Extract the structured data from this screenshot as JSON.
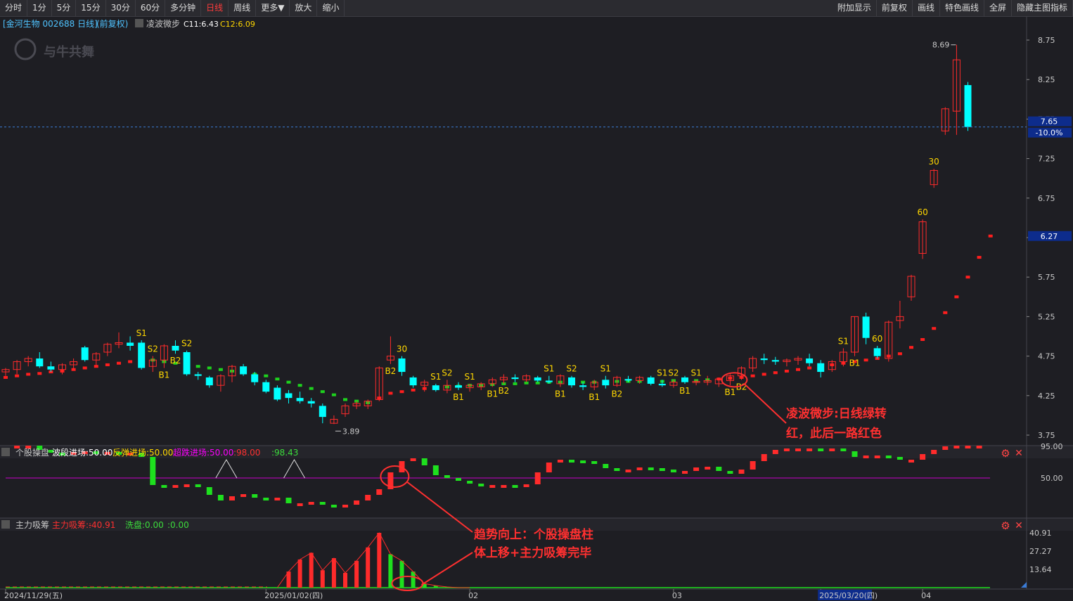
{
  "toolbar": {
    "left": [
      "分时",
      "1分",
      "5分",
      "15分",
      "30分",
      "60分",
      "多分钟",
      "日线",
      "周线",
      "更多▼",
      "放大",
      "缩小"
    ],
    "active": "日线",
    "right": [
      "附加显示",
      "前复权",
      "画线",
      "特色画线",
      "全屏",
      "隐藏主图指标"
    ]
  },
  "colors": {
    "bg": "#1e1e23",
    "up": "#ff2b2b",
    "down": "#00ffff",
    "ma_up": "#ff1e1e",
    "ma_down": "#1ed21e",
    "signal": "#ffd700",
    "grid": "#2e2e34",
    "annot": "#ff3030"
  },
  "main": {
    "stock_label": "[金河生物 002688 日线]",
    "adjust_label": "(前复权)",
    "indicator_name": "凌波微步",
    "c11": "C11:6.43",
    "c12": "C12:6.09",
    "watermark": "与牛共舞",
    "y_ticks": [
      "8.75",
      "8.25",
      "7.75",
      "7.25",
      "6.75",
      "6.25",
      "5.75",
      "5.25",
      "4.75",
      "4.25",
      "3.75"
    ],
    "price_box": "7.65",
    "pct_box": "-10.0%",
    "ma_box": "6.27",
    "high_label": "8.69",
    "low_label": "3.89",
    "annotation": [
      "凌波微步:日线绿转",
      "红，此后一路红色"
    ]
  },
  "panel1": {
    "title": "个股操盘",
    "items": [
      {
        "text": "波段进场:50.00",
        "color": "#ffffff"
      },
      {
        "text": "反弹进场:50.00",
        "color": "#ffd700"
      },
      {
        "text": "超跌进场:50.00",
        "color": "#ff00ff"
      },
      {
        "text": ":98.00",
        "color": "#ff3030"
      },
      {
        "text": ":98.43",
        "color": "#3cdc3c"
      }
    ],
    "y_ticks": [
      "95.00",
      "50.00"
    ]
  },
  "panel2": {
    "title": "主力吸筹",
    "items": [
      {
        "text": "主力吸筹:-",
        "color": "#ff3030"
      },
      {
        "text": ":40.91",
        "color": "#ff3030"
      },
      {
        "text": "洗盘:0.00",
        "color": "#3cdc3c"
      },
      {
        "text": ":0.00",
        "color": "#3cdc3c"
      }
    ],
    "y_ticks": [
      "40.91",
      "27.27",
      "13.64"
    ],
    "annotation": [
      "趋势向上：个股操盘柱",
      "体上移+主力吸筹完毕"
    ]
  },
  "x_axis": {
    "labels": [
      {
        "text": "2024/11/29(五)",
        "idx": 0
      },
      {
        "text": "2025/01/02(四)",
        "idx": 23
      },
      {
        "text": "02",
        "idx": 41
      },
      {
        "text": "03",
        "idx": 59
      },
      {
        "text": "2025/03/20(四)",
        "idx": 72,
        "highlight": true
      },
      {
        "text": "04",
        "idx": 81
      }
    ]
  },
  "chart_data": {
    "type": "candlestick",
    "y_range": [
      3.6,
      8.9
    ],
    "candles": [
      [
        4.55,
        4.6,
        4.5,
        4.58
      ],
      [
        4.58,
        4.7,
        4.52,
        4.68
      ],
      [
        4.68,
        4.75,
        4.62,
        4.72
      ],
      [
        4.72,
        4.8,
        4.6,
        4.62
      ],
      [
        4.62,
        4.68,
        4.55,
        4.58
      ],
      [
        4.58,
        4.66,
        4.52,
        4.64
      ],
      [
        4.64,
        4.72,
        4.58,
        4.68
      ],
      [
        4.86,
        4.88,
        4.68,
        4.7
      ],
      [
        4.7,
        4.8,
        4.62,
        4.78
      ],
      [
        4.8,
        4.92,
        4.75,
        4.9
      ],
      [
        4.9,
        5.05,
        4.85,
        4.92
      ],
      [
        4.92,
        5.0,
        4.82,
        4.88
      ],
      [
        4.92,
        4.95,
        4.58,
        4.6
      ],
      [
        4.62,
        4.75,
        4.55,
        4.7
      ],
      [
        4.7,
        4.9,
        4.6,
        4.88
      ],
      [
        4.88,
        4.95,
        4.78,
        4.82
      ],
      [
        4.8,
        4.82,
        4.5,
        4.52
      ],
      [
        4.52,
        4.55,
        4.45,
        4.5
      ],
      [
        4.48,
        4.5,
        4.35,
        4.38
      ],
      [
        4.38,
        4.52,
        4.3,
        4.5
      ],
      [
        4.5,
        4.64,
        4.42,
        4.62
      ],
      [
        4.62,
        4.65,
        4.5,
        4.52
      ],
      [
        4.52,
        4.55,
        4.38,
        4.42
      ],
      [
        4.42,
        4.45,
        4.28,
        4.3
      ],
      [
        4.35,
        4.38,
        4.18,
        4.2
      ],
      [
        4.28,
        4.32,
        4.15,
        4.22
      ],
      [
        4.22,
        4.3,
        4.15,
        4.18
      ],
      [
        4.18,
        4.22,
        4.1,
        4.15
      ],
      [
        4.12,
        4.15,
        3.9,
        3.98
      ],
      [
        3.9,
        4.0,
        3.89,
        3.95
      ],
      [
        4.02,
        4.15,
        3.98,
        4.12
      ],
      [
        4.12,
        4.18,
        4.08,
        4.15
      ],
      [
        4.12,
        4.2,
        4.08,
        4.18
      ],
      [
        4.2,
        4.62,
        4.18,
        4.6
      ],
      [
        4.7,
        5.0,
        4.65,
        4.75
      ],
      [
        4.72,
        4.75,
        4.5,
        4.55
      ],
      [
        4.48,
        4.5,
        4.35,
        4.38
      ],
      [
        4.38,
        4.45,
        4.3,
        4.42
      ],
      [
        4.38,
        4.4,
        4.3,
        4.32
      ],
      [
        4.32,
        4.45,
        4.28,
        4.38
      ],
      [
        4.38,
        4.42,
        4.32,
        4.35
      ],
      [
        4.35,
        4.4,
        4.3,
        4.38
      ],
      [
        4.36,
        4.42,
        4.32,
        4.4
      ],
      [
        4.4,
        4.48,
        4.36,
        4.45
      ],
      [
        4.45,
        4.52,
        4.4,
        4.48
      ],
      [
        4.48,
        4.52,
        4.42,
        4.46
      ],
      [
        4.45,
        4.52,
        4.42,
        4.5
      ],
      [
        4.48,
        4.5,
        4.42,
        4.44
      ],
      [
        4.44,
        4.5,
        4.4,
        4.42
      ],
      [
        4.4,
        4.52,
        4.36,
        4.5
      ],
      [
        4.48,
        4.5,
        4.35,
        4.38
      ],
      [
        4.38,
        4.42,
        4.32,
        4.36
      ],
      [
        4.36,
        4.45,
        4.32,
        4.42
      ],
      [
        4.45,
        4.5,
        4.34,
        4.38
      ],
      [
        4.38,
        4.5,
        4.36,
        4.48
      ],
      [
        4.46,
        4.5,
        4.42,
        4.44
      ],
      [
        4.44,
        4.5,
        4.4,
        4.48
      ],
      [
        4.48,
        4.5,
        4.38,
        4.4
      ],
      [
        4.4,
        4.45,
        4.36,
        4.38
      ],
      [
        4.38,
        4.45,
        4.35,
        4.42
      ],
      [
        4.48,
        4.5,
        4.4,
        4.42
      ],
      [
        4.42,
        4.45,
        4.38,
        4.43
      ],
      [
        4.42,
        4.5,
        4.38,
        4.44
      ],
      [
        4.4,
        4.48,
        4.36,
        4.46
      ],
      [
        4.44,
        4.52,
        4.38,
        4.5
      ],
      [
        4.5,
        4.62,
        4.45,
        4.6
      ],
      [
        4.6,
        4.75,
        4.55,
        4.72
      ],
      [
        4.72,
        4.78,
        4.65,
        4.7
      ],
      [
        4.7,
        4.74,
        4.64,
        4.68
      ],
      [
        4.68,
        4.72,
        4.62,
        4.7
      ],
      [
        4.7,
        4.75,
        4.64,
        4.72
      ],
      [
        4.72,
        4.78,
        4.62,
        4.66
      ],
      [
        4.66,
        4.7,
        4.48,
        4.55
      ],
      [
        4.58,
        4.7,
        4.55,
        4.68
      ],
      [
        4.68,
        4.85,
        4.62,
        4.8
      ],
      [
        4.8,
        5.25,
        4.75,
        5.25
      ],
      [
        5.25,
        5.3,
        4.9,
        4.98
      ],
      [
        4.85,
        4.88,
        4.72,
        4.75
      ],
      [
        4.72,
        5.2,
        4.68,
        5.18
      ],
      [
        5.2,
        5.45,
        5.1,
        5.25
      ],
      [
        5.5,
        5.78,
        5.45,
        5.76
      ],
      [
        6.05,
        6.48,
        5.98,
        6.45
      ],
      [
        6.92,
        7.12,
        6.88,
        7.1
      ],
      [
        7.6,
        7.9,
        7.55,
        7.88
      ],
      [
        7.85,
        8.69,
        7.55,
        8.5
      ],
      [
        8.18,
        8.22,
        7.6,
        7.65
      ]
    ],
    "ma_values": [
      4.48,
      4.5,
      4.52,
      4.53,
      4.55,
      4.56,
      4.58,
      4.6,
      4.62,
      4.64,
      4.66,
      4.68,
      4.74,
      4.7,
      4.68,
      4.66,
      4.64,
      4.62,
      4.6,
      4.58,
      4.56,
      4.54,
      4.52,
      4.5,
      4.46,
      4.42,
      4.38,
      4.34,
      4.3,
      4.26,
      4.2,
      4.18,
      4.16,
      4.22,
      4.28,
      4.3,
      4.32,
      4.34,
      4.35,
      4.36,
      4.37,
      4.38,
      4.38,
      4.39,
      4.4,
      4.4,
      4.41,
      4.41,
      4.42,
      4.42,
      4.42,
      4.42,
      4.42,
      4.43,
      4.43,
      4.43,
      4.43,
      4.43,
      4.43,
      4.44,
      4.44,
      4.44,
      4.45,
      4.46,
      4.47,
      4.48,
      4.5,
      4.52,
      4.54,
      4.56,
      4.58,
      4.6,
      4.62,
      4.64,
      4.66,
      4.68,
      4.7,
      4.72,
      4.75,
      4.78,
      4.86,
      4.96,
      5.1,
      5.3,
      5.5,
      5.75,
      6.0,
      6.27
    ],
    "ma_red_from": 63,
    "ma_red_ranges": [
      [
        0,
        11
      ],
      [
        33,
        37
      ],
      [
        63,
        87
      ]
    ],
    "signals": [
      {
        "text": "S1",
        "idx": 12,
        "pos": "top"
      },
      {
        "text": "S2",
        "idx": 13,
        "pos": "top"
      },
      {
        "text": "S2",
        "idx": 16,
        "pos": "top"
      },
      {
        "text": "B2",
        "idx": 15,
        "pos": "bottom"
      },
      {
        "text": "B1",
        "idx": 14,
        "pos": "bottom"
      },
      {
        "text": "30",
        "idx": 35,
        "pos": "top"
      },
      {
        "text": "B2",
        "idx": 34,
        "pos": "bottom"
      },
      {
        "text": "S1",
        "idx": 38,
        "pos": "top"
      },
      {
        "text": "S2",
        "idx": 39,
        "pos": "top"
      },
      {
        "text": "B1",
        "idx": 40,
        "pos": "bottom"
      },
      {
        "text": "S1",
        "idx": 41,
        "pos": "top"
      },
      {
        "text": "B2",
        "idx": 44,
        "pos": "bottom"
      },
      {
        "text": "B1",
        "idx": 43,
        "pos": "bottom"
      },
      {
        "text": "S1",
        "idx": 48,
        "pos": "top"
      },
      {
        "text": "B1",
        "idx": 49,
        "pos": "bottom"
      },
      {
        "text": "S2",
        "idx": 50,
        "pos": "top"
      },
      {
        "text": "S1",
        "idx": 53,
        "pos": "top"
      },
      {
        "text": "B1",
        "idx": 52,
        "pos": "bottom"
      },
      {
        "text": "B2",
        "idx": 54,
        "pos": "bottom"
      },
      {
        "text": "S1",
        "idx": 58,
        "pos": "top"
      },
      {
        "text": "S2",
        "idx": 59,
        "pos": "top"
      },
      {
        "text": "B1",
        "idx": 60,
        "pos": "bottom"
      },
      {
        "text": "S1",
        "idx": 61,
        "pos": "top"
      },
      {
        "text": "B1",
        "idx": 64,
        "pos": "bottom"
      },
      {
        "text": "B2",
        "idx": 65,
        "pos": "bottom"
      },
      {
        "text": "S1",
        "idx": 74,
        "pos": "top"
      },
      {
        "text": "B1",
        "idx": 75,
        "pos": "bottom"
      },
      {
        "text": "60",
        "idx": 77,
        "pos": "top"
      },
      {
        "text": "30",
        "idx": 82,
        "pos": "top"
      },
      {
        "text": "60",
        "idx": 81,
        "pos": "top"
      }
    ],
    "panel1_values": [
      96,
      96,
      96,
      90,
      86,
      84,
      87,
      88,
      86,
      87,
      86,
      86,
      80,
      40,
      38,
      40,
      41,
      37,
      26,
      18,
      24,
      27,
      22,
      19,
      22,
      14,
      14,
      16,
      12,
      10,
      12,
      18,
      26,
      34,
      58,
      74,
      78,
      68,
      54,
      50,
      46,
      42,
      40,
      40,
      40,
      38,
      41,
      58,
      72,
      76,
      75,
      74,
      70,
      64,
      60,
      62,
      65,
      64,
      62,
      58,
      60,
      65,
      66,
      60,
      56,
      62,
      74,
      84,
      90,
      92,
      92,
      92,
      90,
      92,
      88,
      80,
      82,
      82,
      80,
      76,
      76,
      84,
      90,
      95,
      96,
      96,
      96
    ],
    "panel2_values": [
      0,
      0,
      0,
      0,
      0,
      0,
      0,
      0,
      0,
      0,
      0,
      0,
      0,
      0,
      0,
      0,
      0,
      0,
      0,
      0,
      0,
      0,
      0,
      0,
      0,
      12,
      21,
      26,
      13,
      22,
      11,
      20,
      30,
      40.91,
      25,
      20,
      12,
      3,
      1.5,
      0.5,
      0,
      0
    ]
  }
}
